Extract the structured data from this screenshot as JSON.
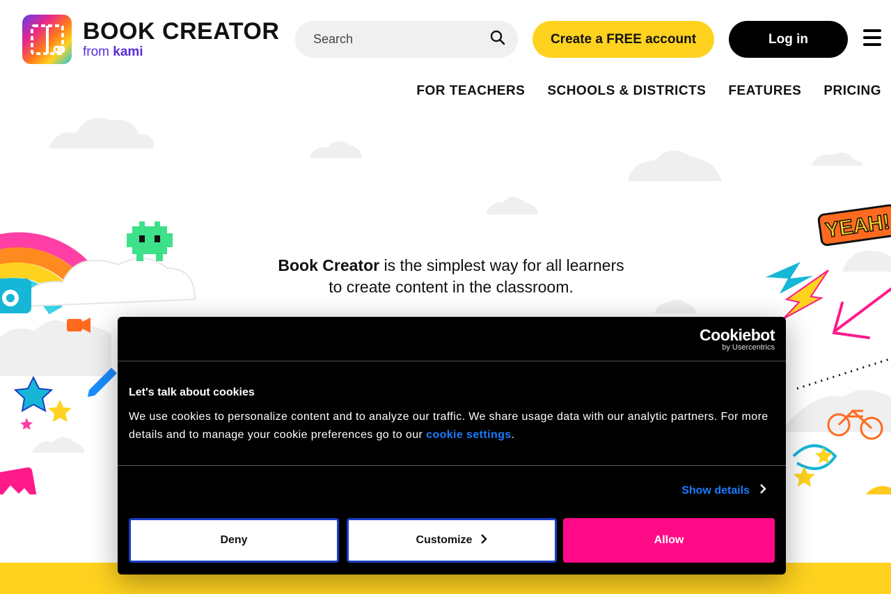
{
  "header": {
    "brand_name": "BOOK CREATOR",
    "brand_from": "from",
    "brand_kami": "kami",
    "search_placeholder": "Search",
    "create_account_label": "Create a FREE account",
    "login_label": "Log in"
  },
  "nav": {
    "items": [
      {
        "label": "FOR TEACHERS"
      },
      {
        "label": "SCHOOLS & DISTRICTS"
      },
      {
        "label": "FEATURES"
      },
      {
        "label": "PRICING"
      }
    ]
  },
  "hero": {
    "strong": "Book Creator",
    "line1_rest": " is the simplest way for all learners",
    "line2": "to create content in the classroom.",
    "sticker_text": "YEAH!"
  },
  "cookie_dialog": {
    "brand_name": "Cookiebot",
    "brand_by": "by Usercentrics",
    "title": "Let's talk about cookies",
    "body_text": "We use cookies to personalize content and to analyze our traffic. We share usage data with our analytic partners. For more details and to manage your cookie preferences go to our ",
    "body_link": "cookie settings",
    "body_end": ".",
    "show_details_label": "Show details",
    "deny_label": "Deny",
    "customize_label": "Customize",
    "allow_label": "Allow"
  },
  "icons": {
    "search": "search-icon",
    "menu": "hamburger-menu-icon",
    "chevron": "chevron-right-icon"
  },
  "colors": {
    "brand_yellow": "#ffd21f",
    "allow_pink": "#ff0a87",
    "link_blue": "#1a7cff",
    "kami_purple": "#5a2bd6"
  }
}
